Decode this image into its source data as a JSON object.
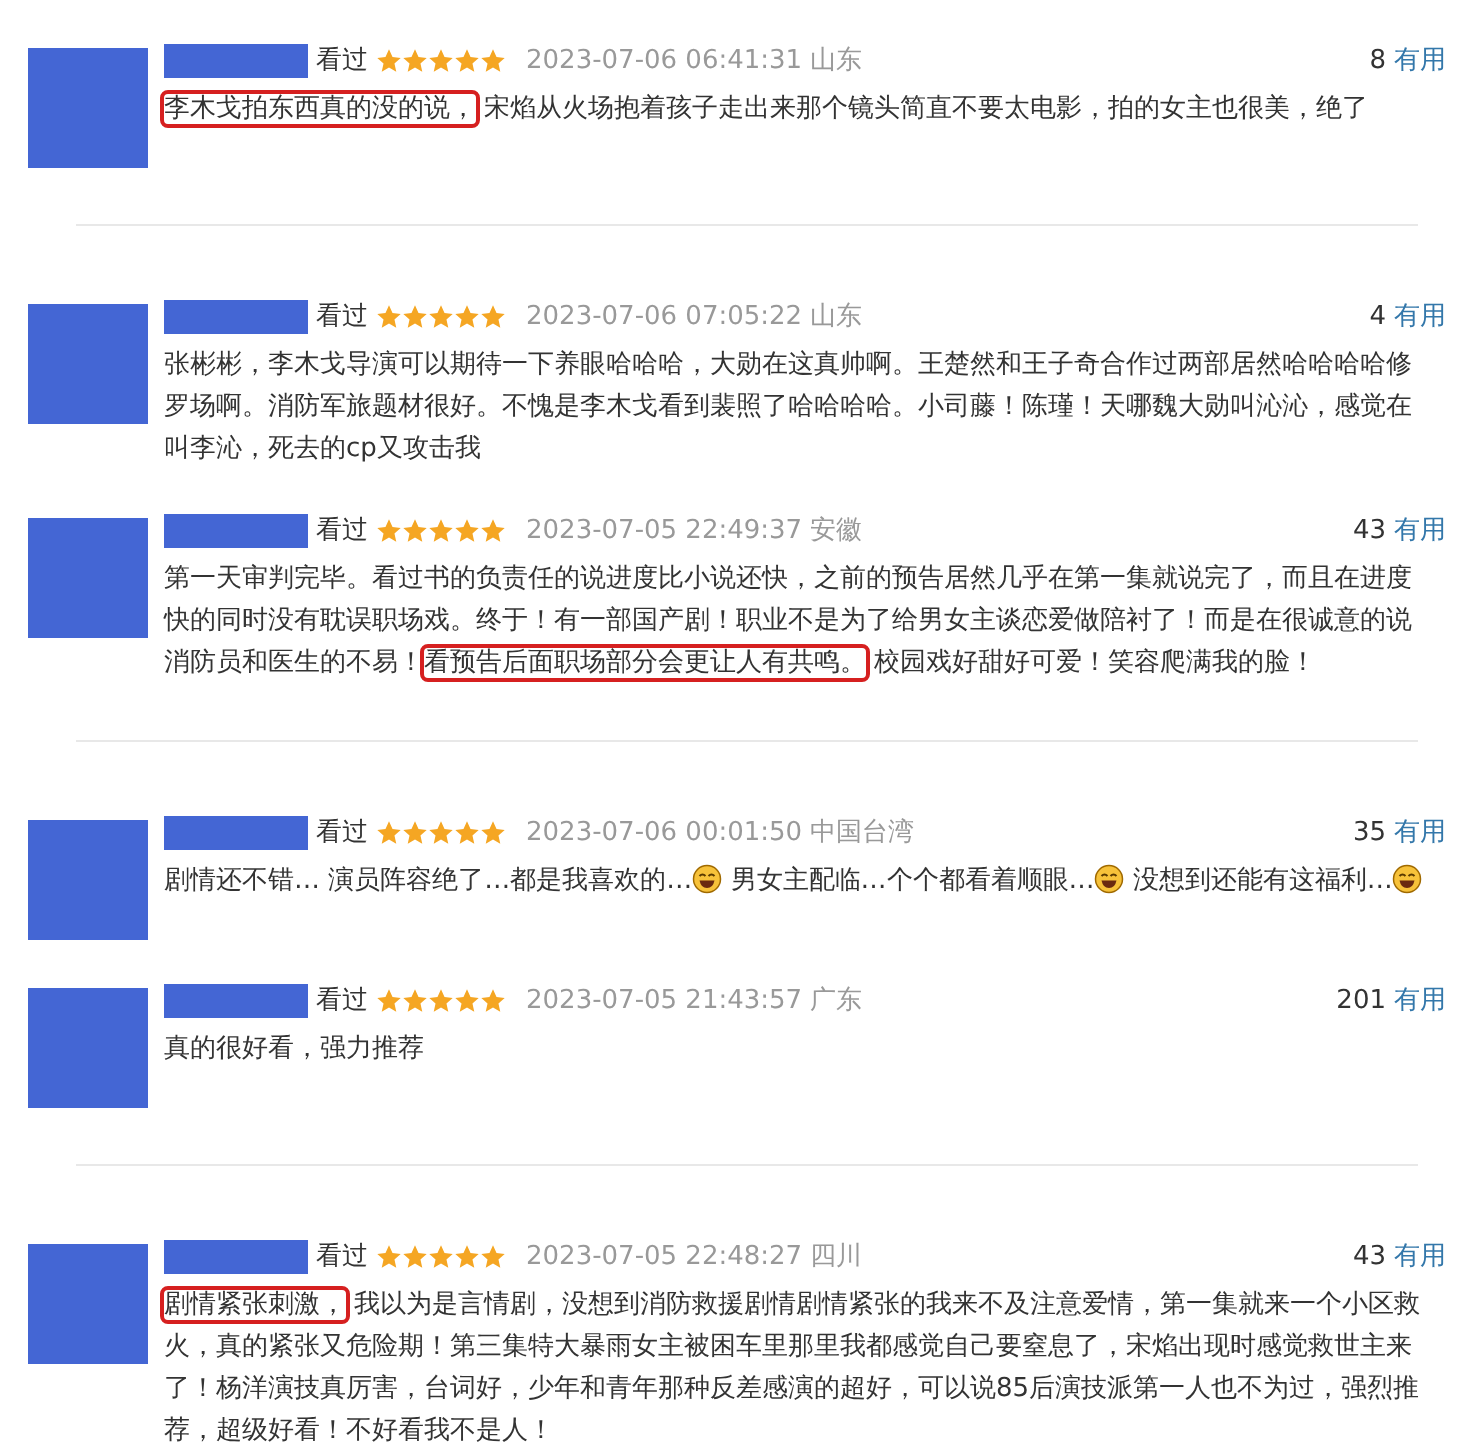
{
  "items": [
    {
      "kind": "review",
      "status": "看过",
      "stars": 5,
      "time": "2023-07-06 06:41:31",
      "location": "山东",
      "count": "8",
      "useful": "有用",
      "body": [
        {
          "text": "李木戈拍东西真的没的说，",
          "highlighted": true
        },
        {
          "text": "宋焰从火场抱着孩子走出来那个镜头简直不要太电影，拍的女主也很美，绝了",
          "highlighted": false
        }
      ]
    },
    {
      "kind": "divider"
    },
    {
      "kind": "review",
      "status": "看过",
      "stars": 5,
      "time": "2023-07-06 07:05:22",
      "location": "山东",
      "count": "4",
      "useful": "有用",
      "body": [
        {
          "text": "张彬彬，李木戈导演可以期待一下养眼哈哈哈，大勋在这真帅啊。王楚然和王子奇合作过两部居然哈哈哈哈修罗场啊。消防军旅题材很好。不愧是李木戈看到裴照了哈哈哈哈。小司藤！陈瑾！天哪魏大勋叫沁沁，感觉在叫李沁，死去的cp又攻击我",
          "highlighted": false
        }
      ]
    },
    {
      "kind": "review",
      "status": "看过",
      "stars": 5,
      "time": "2023-07-05 22:49:37",
      "location": "安徽",
      "count": "43",
      "useful": "有用",
      "body": [
        {
          "text": "第一天审判完毕。看过书的负责任的说进度比小说还快，之前的预告居然几乎在第一集就说完了，而且在进度快的同时没有耽误职场戏。终于！有一部国产剧！职业不是为了给男女主谈恋爱做陪衬了！而是在很诚意的说消防员和医生的不易！",
          "highlighted": false
        },
        {
          "text": "看预告后面职场部分会更让人有共鸣。",
          "highlighted": true
        },
        {
          "text": "校园戏好甜好可爱！笑容爬满我的脸！",
          "highlighted": false
        }
      ]
    },
    {
      "kind": "divider"
    },
    {
      "kind": "review",
      "status": "看过",
      "stars": 5,
      "time": "2023-07-06 00:01:50",
      "location": "中国台湾",
      "count": "35",
      "useful": "有用",
      "body": [
        {
          "text": "剧情还不错… 演员阵容绝了…都是我喜欢的…",
          "highlighted": false
        },
        {
          "kind": "emoji"
        },
        {
          "text": " 男女主配临…个个都看着顺眼…",
          "highlighted": false
        },
        {
          "kind": "emoji"
        },
        {
          "text": " 没想到还能有这福利…",
          "highlighted": false
        },
        {
          "kind": "emoji"
        }
      ]
    },
    {
      "kind": "review",
      "status": "看过",
      "stars": 5,
      "time": "2023-07-05 21:43:57",
      "location": "广东",
      "count": "201",
      "useful": "有用",
      "body": [
        {
          "text": "真的很好看，强力推荐",
          "highlighted": false
        }
      ]
    },
    {
      "kind": "divider"
    },
    {
      "kind": "review",
      "status": "看过",
      "stars": 5,
      "time": "2023-07-05 22:48:27",
      "location": "四川",
      "count": "43",
      "useful": "有用",
      "body": [
        {
          "text": "剧情紧张刺激，",
          "highlighted": true
        },
        {
          "text": "我以为是言情剧，没想到消防救援剧情剧情紧张的我来不及注意爱情，第一集就来一个小区救火，真的紧张又危险期！第三集特大暴雨女主被困车里那里我都感觉自己要窒息了，宋焰出现时感觉救世主来了！杨洋演技真厉害，台词好，少年和青年那种反差感演的超好，可以说85后演技派第一人也不为过，强烈推荐，超级好看！不好看我不是人！",
          "highlighted": false
        }
      ]
    }
  ]
}
